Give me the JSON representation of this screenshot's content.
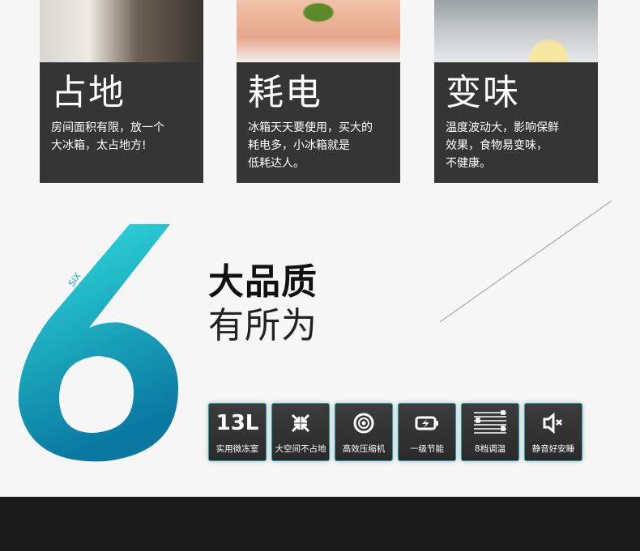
{
  "cards": [
    {
      "title": "占地",
      "desc": "房间面积有限，放一个\n大冰箱，太占地方!"
    },
    {
      "title": "耗电",
      "desc": "冰箱天天要使用，买大的\n耗电多，小冰箱就是\n低耗达人。"
    },
    {
      "title": "变味",
      "desc": "温度波动大，影响保鲜\n效果，食物易变味，\n不健康。"
    }
  ],
  "hero": {
    "number": "6",
    "number_word": "SIX",
    "headline_bold": "大品质",
    "headline_light": "有所为"
  },
  "features": [
    {
      "icon": "13L",
      "label": "实用微冻室"
    },
    {
      "icon": "compress-arrows-icon",
      "label": "大空间不占地"
    },
    {
      "icon": "compressor-disc-icon",
      "label": "高效压缩机"
    },
    {
      "icon": "battery-charge-icon",
      "label": "一级节能"
    },
    {
      "icon": "slider-levels-icon",
      "label": "8档调温"
    },
    {
      "icon": "speaker-mute-icon",
      "label": "静音好安睡"
    }
  ],
  "colors": {
    "accent_start": "#22d3dc",
    "accent_end": "#0a7aa0",
    "panel": "#353535"
  }
}
